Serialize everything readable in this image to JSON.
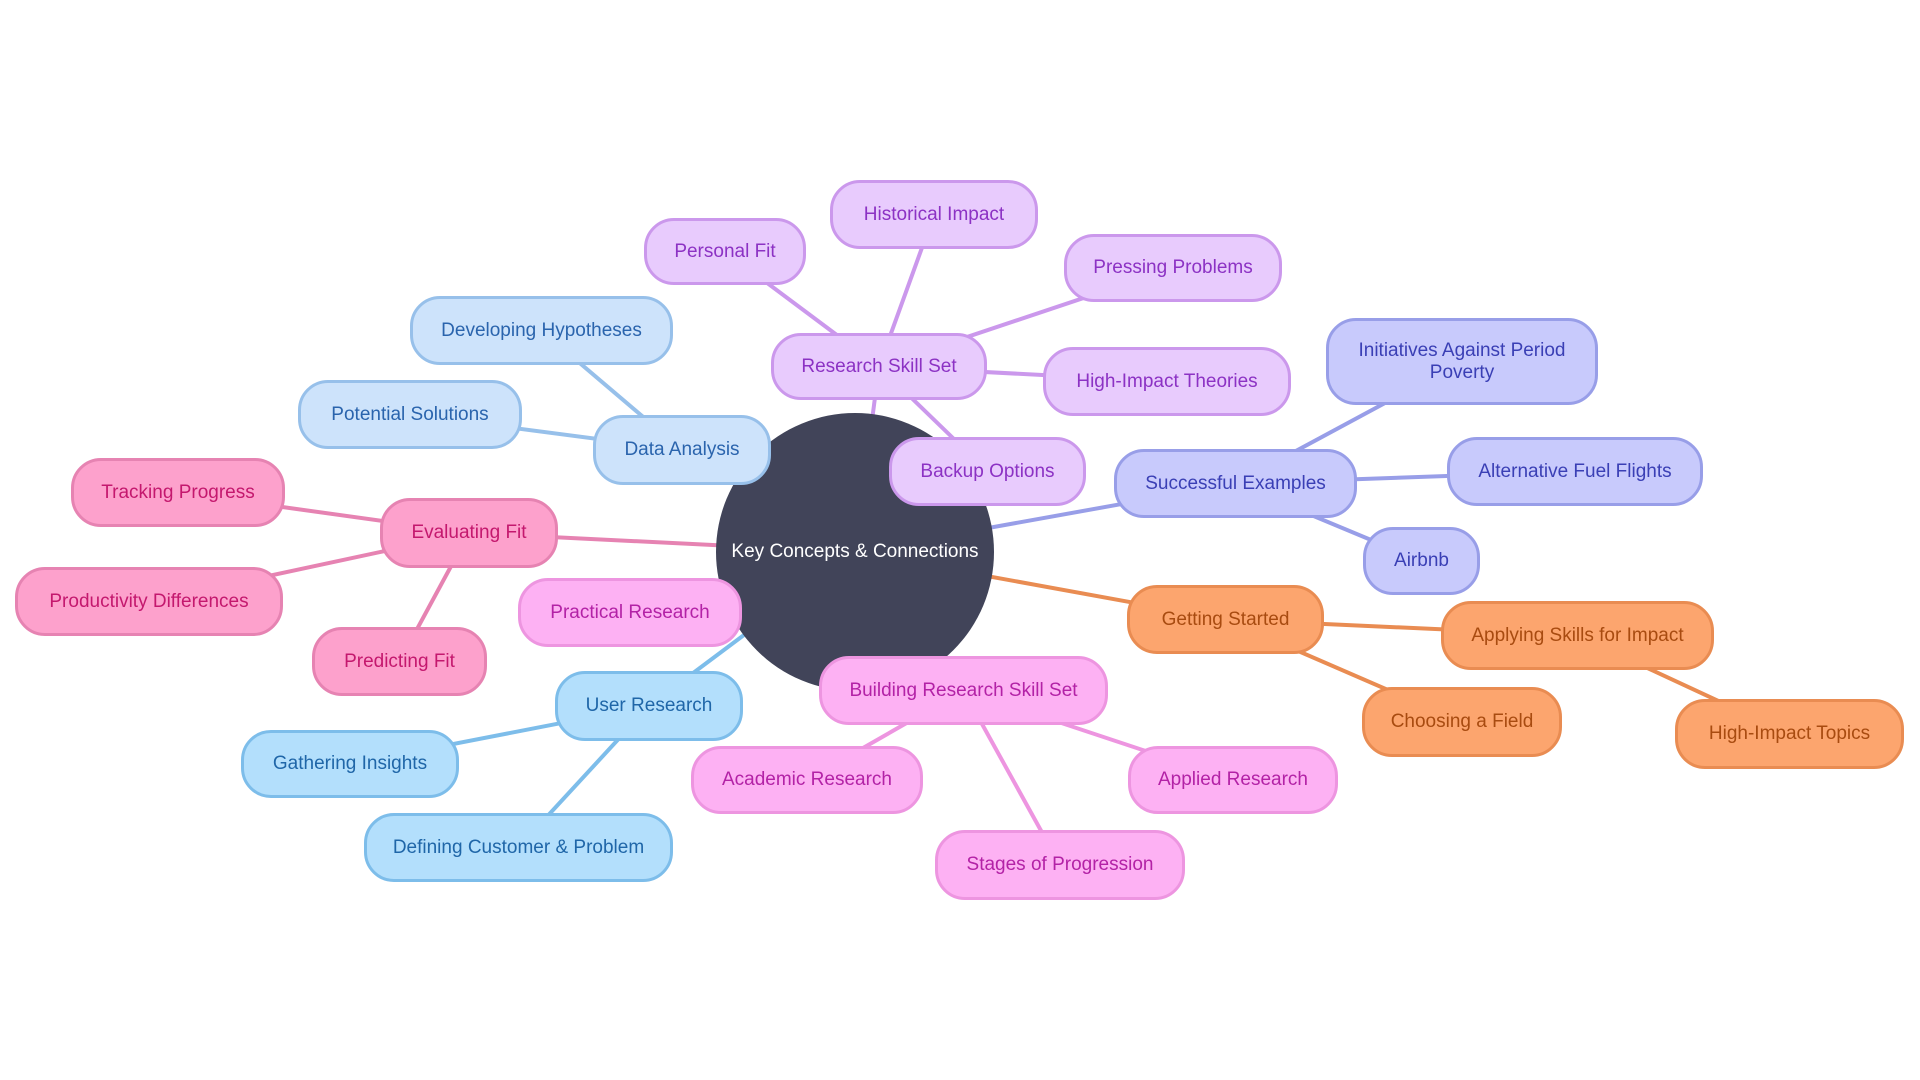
{
  "diagram": {
    "type": "mindmap",
    "root": {
      "id": "root",
      "label": "Key Concepts & Connections"
    },
    "colors": {
      "root": "#414459",
      "purple": "#cb98ec",
      "lblue": "#97c0ea",
      "pink": "#e683b2",
      "magenta": "#ed95e0",
      "sky": "#7dbdea",
      "indigo": "#989ee8",
      "orange": "#e98c52"
    },
    "nodes": [
      {
        "id": "research-skill-set",
        "label": "Research Skill Set",
        "parent": "root",
        "color": "purple"
      },
      {
        "id": "personal-fit",
        "label": "Personal Fit",
        "parent": "research-skill-set",
        "color": "purple"
      },
      {
        "id": "historical-impact",
        "label": "Historical Impact",
        "parent": "research-skill-set",
        "color": "purple"
      },
      {
        "id": "pressing-problems",
        "label": "Pressing Problems",
        "parent": "research-skill-set",
        "color": "purple"
      },
      {
        "id": "high-impact-theories",
        "label": "High-Impact Theories",
        "parent": "research-skill-set",
        "color": "purple"
      },
      {
        "id": "backup-options",
        "label": "Backup Options",
        "parent": "research-skill-set",
        "color": "purple"
      },
      {
        "id": "data-analysis",
        "label": "Data Analysis",
        "parent": "root",
        "color": "lblue"
      },
      {
        "id": "developing-hypotheses",
        "label": "Developing Hypotheses",
        "parent": "data-analysis",
        "color": "lblue"
      },
      {
        "id": "potential-solutions",
        "label": "Potential Solutions",
        "parent": "data-analysis",
        "color": "lblue"
      },
      {
        "id": "evaluating-fit",
        "label": "Evaluating Fit",
        "parent": "root",
        "color": "pink"
      },
      {
        "id": "tracking-progress",
        "label": "Tracking Progress",
        "parent": "evaluating-fit",
        "color": "pink"
      },
      {
        "id": "productivity-differences",
        "label": "Productivity Differences",
        "parent": "evaluating-fit",
        "color": "pink"
      },
      {
        "id": "predicting-fit",
        "label": "Predicting Fit",
        "parent": "evaluating-fit",
        "color": "pink"
      },
      {
        "id": "user-research",
        "label": "User Research",
        "parent": "root",
        "color": "sky"
      },
      {
        "id": "gathering-insights",
        "label": "Gathering Insights",
        "parent": "user-research",
        "color": "sky"
      },
      {
        "id": "defining-customer-problem",
        "label": "Defining Customer & Problem",
        "parent": "user-research",
        "color": "sky"
      },
      {
        "id": "building-research-skill-set",
        "label": "Building Research Skill Set",
        "parent": "root",
        "color": "magenta"
      },
      {
        "id": "practical-research",
        "label": "Practical Research",
        "parent": "building-research-skill-set",
        "color": "magenta"
      },
      {
        "id": "academic-research",
        "label": "Academic Research",
        "parent": "building-research-skill-set",
        "color": "magenta"
      },
      {
        "id": "stages-of-progression",
        "label": "Stages of Progression",
        "parent": "building-research-skill-set",
        "color": "magenta"
      },
      {
        "id": "applied-research",
        "label": "Applied Research",
        "parent": "building-research-skill-set",
        "color": "magenta"
      },
      {
        "id": "successful-examples",
        "label": "Successful Examples",
        "parent": "root",
        "color": "indigo"
      },
      {
        "id": "initiatives-period-poverty",
        "label": "Initiatives Against Period Poverty",
        "parent": "successful-examples",
        "color": "indigo"
      },
      {
        "id": "alternative-fuel-flights",
        "label": "Alternative Fuel Flights",
        "parent": "successful-examples",
        "color": "indigo"
      },
      {
        "id": "airbnb",
        "label": "Airbnb",
        "parent": "successful-examples",
        "color": "indigo"
      },
      {
        "id": "getting-started",
        "label": "Getting Started",
        "parent": "root",
        "color": "orange"
      },
      {
        "id": "applying-skills-impact",
        "label": "Applying Skills for Impact",
        "parent": "getting-started",
        "color": "orange"
      },
      {
        "id": "choosing-a-field",
        "label": "Choosing a Field",
        "parent": "getting-started",
        "color": "orange"
      },
      {
        "id": "high-impact-topics",
        "label": "High-Impact Topics",
        "parent": "applying-skills-impact",
        "color": "orange"
      }
    ]
  }
}
